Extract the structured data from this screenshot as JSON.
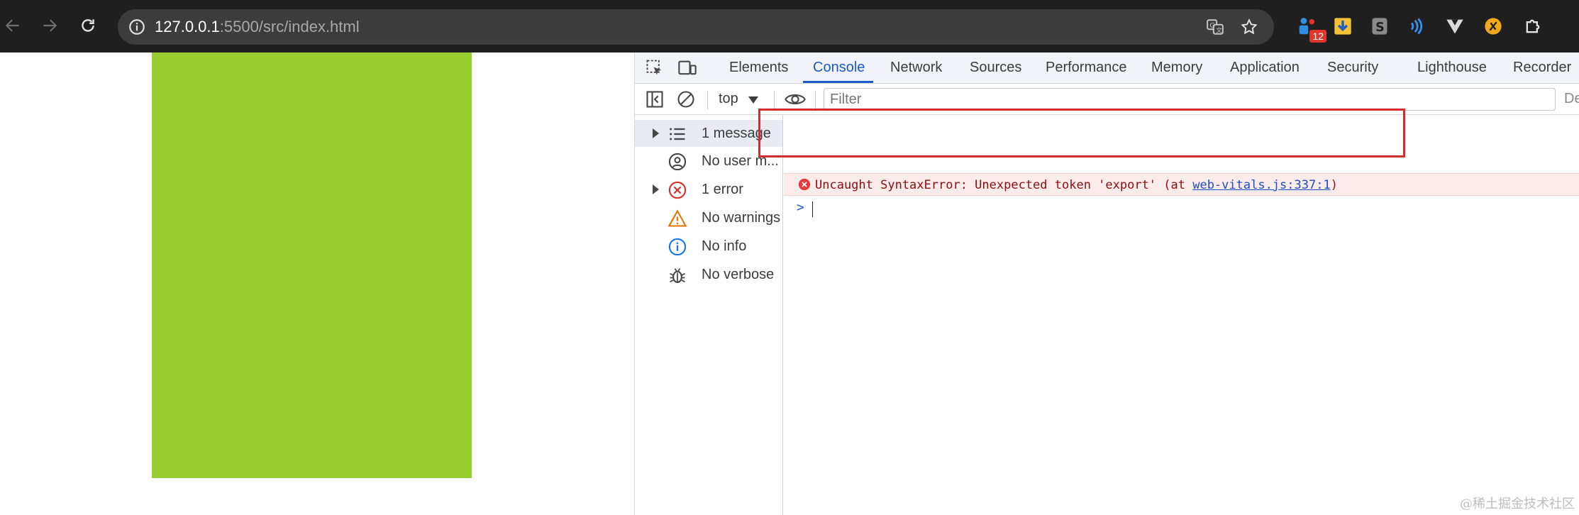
{
  "browser": {
    "url_host": "127.0.0.1",
    "url_rest": ":5500/src/index.html",
    "extensions": [
      {
        "name": "extension-icon-1",
        "badge": "12"
      },
      {
        "name": "download-extension-icon"
      },
      {
        "name": "s-extension-icon"
      },
      {
        "name": "wave-extension-icon"
      },
      {
        "name": "vue-extension-icon"
      },
      {
        "name": "orange-extension-icon"
      },
      {
        "name": "puzzle-extensions-icon"
      }
    ]
  },
  "devtools": {
    "tabs": [
      "Elements",
      "Console",
      "Network",
      "Sources",
      "Performance",
      "Memory",
      "Application",
      "Security",
      "Lighthouse",
      "Recorder"
    ],
    "active_tab": "Console",
    "toolbar": {
      "context": "top",
      "filter_placeholder": "Filter",
      "levels": "De"
    },
    "sidebar": [
      {
        "label": "1 message",
        "icon": "list-icon",
        "expandable": true,
        "selected": true
      },
      {
        "label": "No user m...",
        "icon": "user-icon",
        "expandable": false
      },
      {
        "label": "1 error",
        "icon": "error-icon",
        "expandable": true
      },
      {
        "label": "No warnings",
        "icon": "warning-icon",
        "expandable": false
      },
      {
        "label": "No info",
        "icon": "info-icon",
        "expandable": false
      },
      {
        "label": "No verbose",
        "icon": "bug-icon",
        "expandable": false
      }
    ],
    "error": {
      "text": "Uncaught SyntaxError: Unexpected token 'export' (at ",
      "link": "web-vitals.js:337:1",
      "close": ")"
    },
    "prompt_symbol": ">"
  },
  "watermark": "@稀土掘金技术社区",
  "colors": {
    "page_box": "#9acd2f",
    "highlight": "#d32d2d",
    "active_tab": "#1a5bc7"
  }
}
